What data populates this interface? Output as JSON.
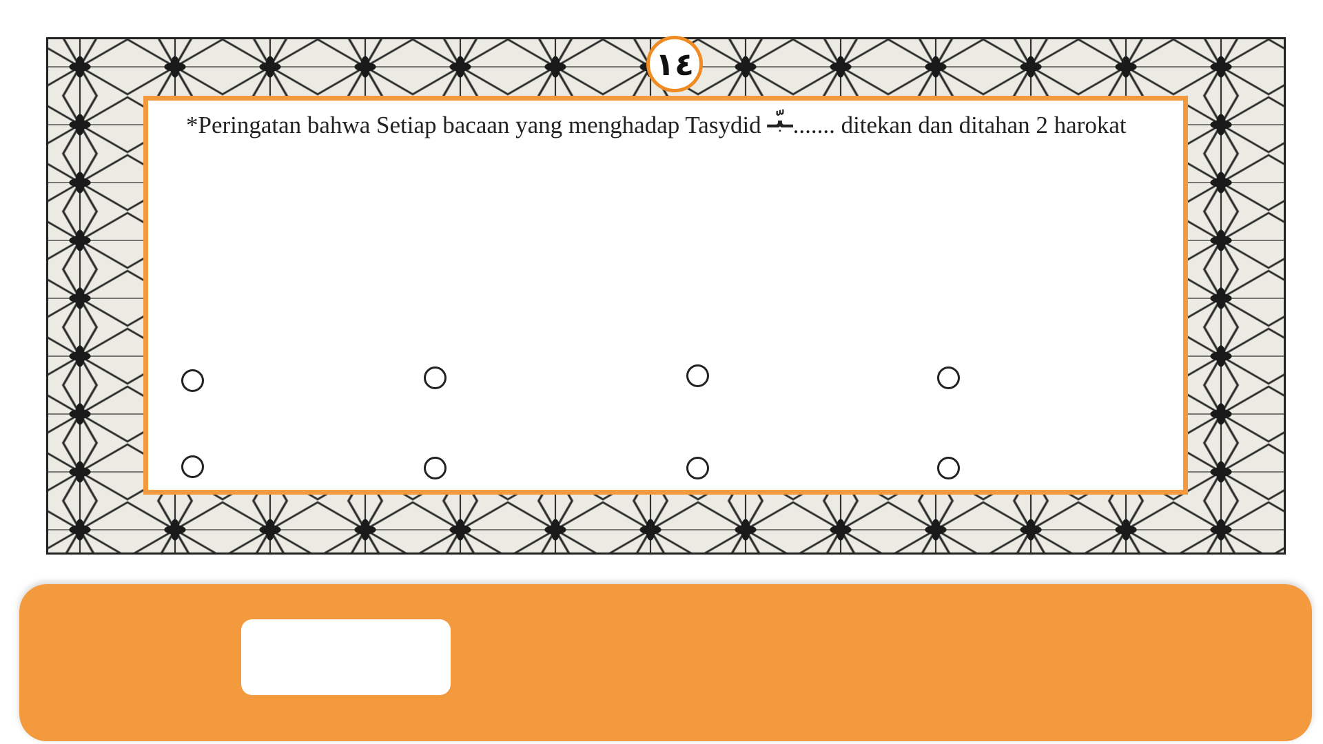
{
  "page_number": "١٤",
  "instruction": {
    "text_before": "*Peringatan bahwa Setiap bacaan yang menghadap Tasydid ",
    "arabic_marker": "ـبّـ",
    "blank": ".......",
    "text_after": " ditekan dan ditahan 2 harokat"
  },
  "options": [
    {
      "row": 1,
      "col": 1,
      "selected": false
    },
    {
      "row": 1,
      "col": 2,
      "selected": false
    },
    {
      "row": 1,
      "col": 3,
      "selected": false
    },
    {
      "row": 1,
      "col": 4,
      "selected": false
    },
    {
      "row": 2,
      "col": 1,
      "selected": false
    },
    {
      "row": 2,
      "col": 2,
      "selected": false
    },
    {
      "row": 2,
      "col": 3,
      "selected": false
    },
    {
      "row": 2,
      "col": 4,
      "selected": false
    }
  ],
  "answer_box": {
    "value": ""
  },
  "colors": {
    "accent_orange": "#f39a3e",
    "badge_ring": "#f08a22",
    "frame_background": "#ecebe3",
    "text": "#222222"
  }
}
